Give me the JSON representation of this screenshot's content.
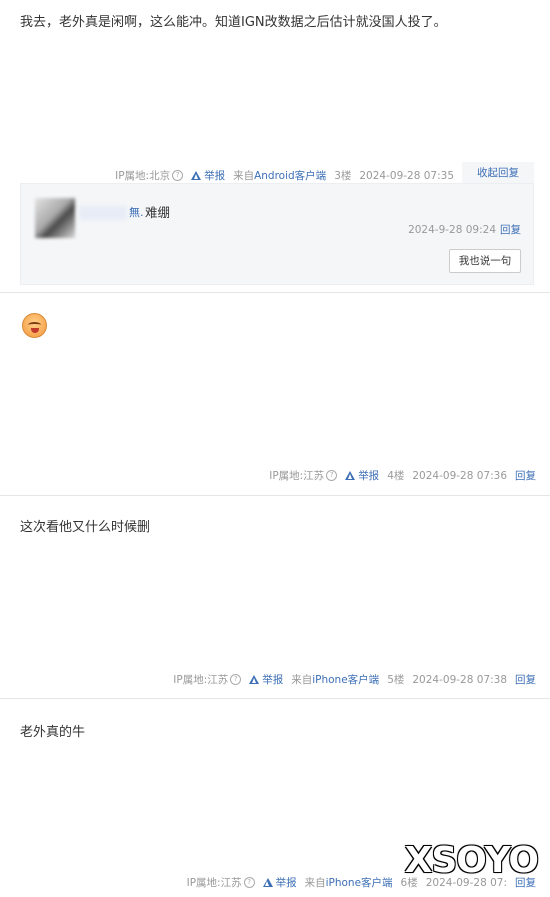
{
  "posts": [
    {
      "content": "我去，老外真是闲啊，这么能冲。知道IGN改数据之后估计就没国人投了。",
      "ip": "IP属地:北京",
      "report": "举报",
      "source": "来自",
      "client": "Android客户端",
      "floor": "3楼",
      "time": "2024-09-28 07:35",
      "action": "收起回复",
      "reply": {
        "user": "無.",
        "text": "难绷",
        "time": "2024-9-28 09:24",
        "reply_label": "回复",
        "say_button": "我也说一句"
      }
    },
    {
      "content": "",
      "emoji": "laughing-face",
      "ip": "IP属地:江苏",
      "report": "举报",
      "floor": "4楼",
      "time": "2024-09-28 07:36",
      "action": "回复"
    },
    {
      "content": "这次看他又什么时候删",
      "ip": "IP属地:江苏",
      "report": "举报",
      "source": "来自",
      "client": "iPhone客户端",
      "floor": "5楼",
      "time": "2024-09-28 07:38",
      "action": "回复"
    },
    {
      "content": "老外真的牛",
      "ip": "IP属地:江苏",
      "report": "举报",
      "source": "来自",
      "client": "iPhone客户端",
      "floor": "6楼",
      "time": "2024-09-28 07:",
      "action": "回复"
    }
  ],
  "watermark": "XSOYO",
  "colors": {
    "link": "#3d6fb6",
    "meta": "#999999",
    "reply_bg": "#f5f6f8"
  }
}
